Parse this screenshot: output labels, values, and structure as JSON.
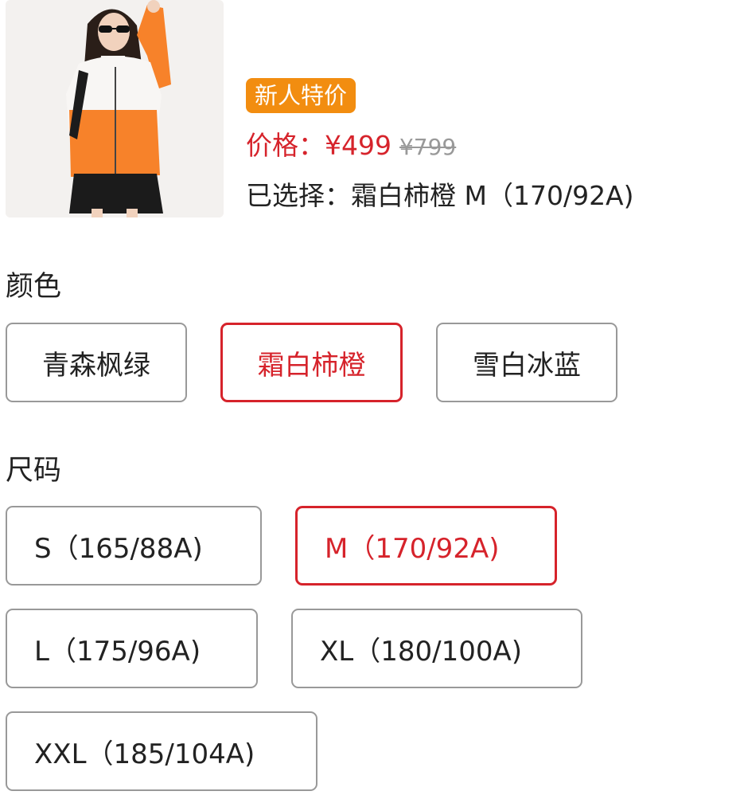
{
  "product": {
    "image_name": "product-photo",
    "badge": "新人特价",
    "price_label": "价格：",
    "price_current": "¥499",
    "price_original": "¥799",
    "selected_text": "已选择：霜白柿橙 M（170/92A)"
  },
  "color_section": {
    "title": "颜色",
    "options": [
      {
        "label": "青森枫绿",
        "selected": false
      },
      {
        "label": "霜白柿橙",
        "selected": true
      },
      {
        "label": "雪白冰蓝",
        "selected": false
      }
    ]
  },
  "size_section": {
    "title": "尺码",
    "options": [
      {
        "label": "S（165/88A)",
        "selected": false
      },
      {
        "label": "M（170/92A)",
        "selected": true
      },
      {
        "label": "L（175/96A)",
        "selected": false
      },
      {
        "label": "XL（180/100A)",
        "selected": false
      },
      {
        "label": "XXL（185/104A)",
        "selected": false
      }
    ]
  },
  "colors": {
    "accent_red": "#d6232b",
    "badge_orange": "#f28d10",
    "border_gray": "#999999",
    "muted_gray": "#999999"
  }
}
